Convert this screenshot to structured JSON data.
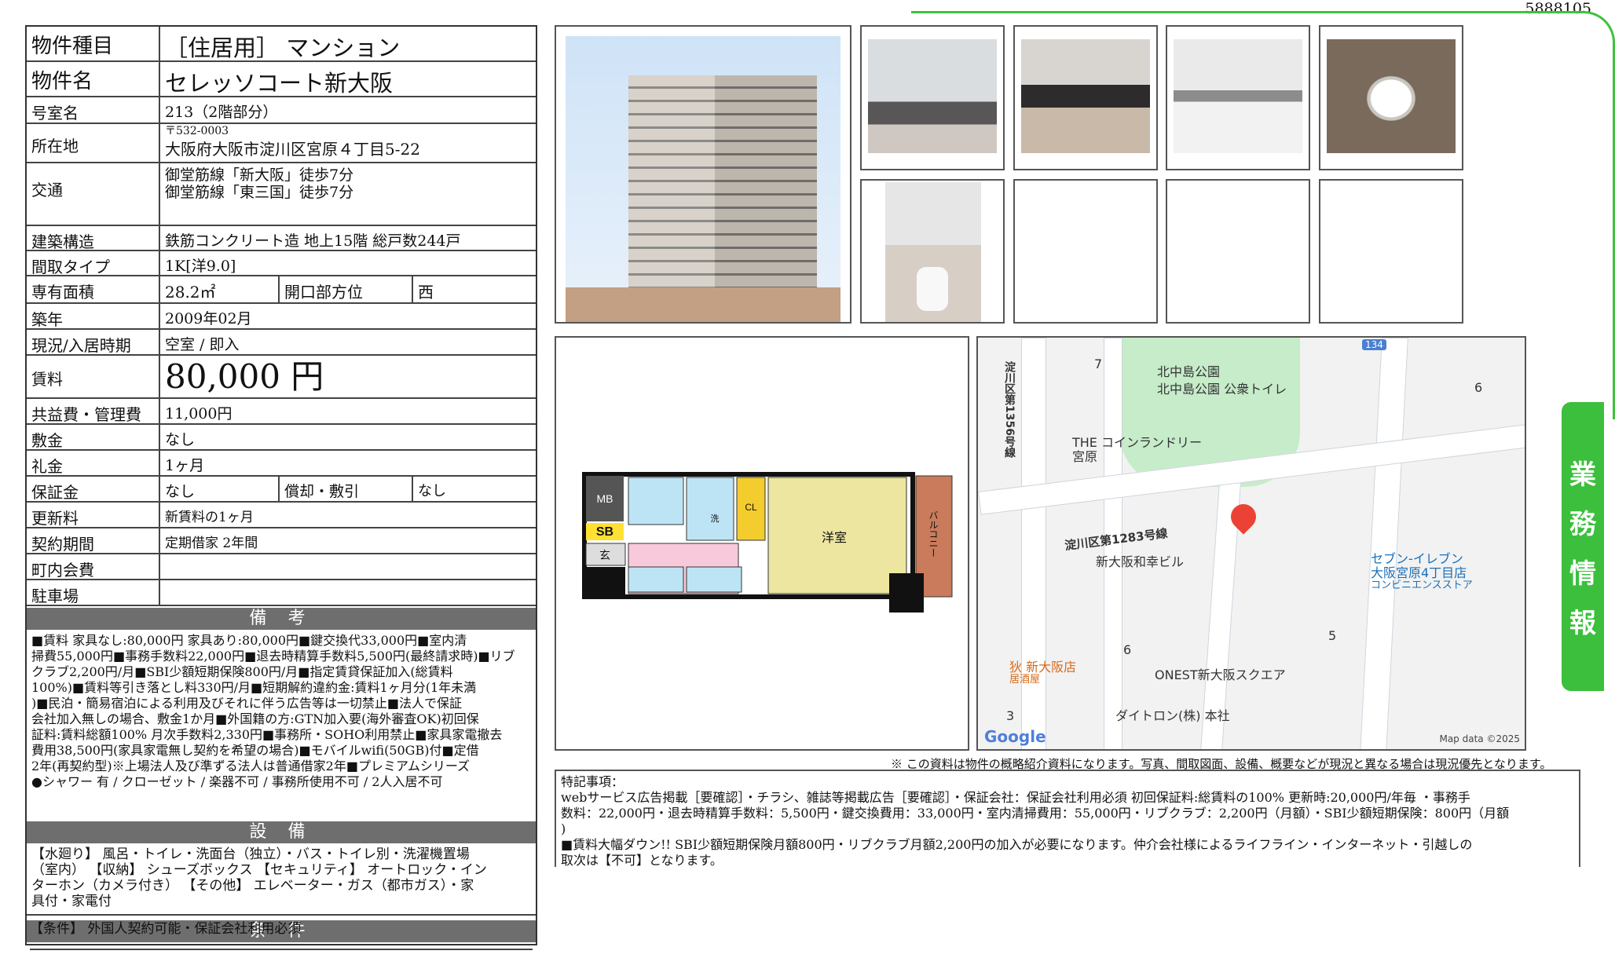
{
  "doc_id": "5888105",
  "side_tab": [
    "業",
    "務",
    "情",
    "報"
  ],
  "property": {
    "type_label": "物件種目",
    "type_value": "［住居用］ マンション",
    "name_label": "物件名",
    "name_value": "セレッソコート新大阪",
    "room_label": "号室名",
    "room_value": "213（2階部分）",
    "address_label": "所在地",
    "postal": "〒532-0003",
    "address": "大阪府大阪市淀川区宮原４丁目5-22",
    "transit_label": "交通",
    "transit_1": "御堂筋線「新大阪」徒歩7分",
    "transit_2": "御堂筋線「東三国」徒歩7分",
    "structure_label": "建築構造",
    "structure_value": "鉄筋コンクリート造 地上15階 総戸数244戸",
    "layout_label": "間取タイプ",
    "layout_value": "1K[洋9.0]",
    "area_label": "専有面積",
    "area_value": "28.2㎡",
    "opening_label": "開口部方位",
    "opening_value": "西",
    "built_label": "築年",
    "built_value": "2009年02月",
    "status_label": "現況/入居時期",
    "status_value": "空室 / 即入",
    "rent_label": "賃料",
    "rent_value": "80,000 円",
    "fee_label": "共益費・管理費",
    "fee_value": "11,000円",
    "deposit_label": "敷金",
    "deposit_value": "なし",
    "key_money_label": "礼金",
    "key_money_value": "1ヶ月",
    "guarantee_label": "保証金",
    "guarantee_value": "なし",
    "amort_label": "償却・敷引",
    "amort_value": "なし",
    "renewal_label": "更新料",
    "renewal_value": "新賃料の1ヶ月",
    "contract_label": "契約期間",
    "contract_value": "定期借家 2年間",
    "town_fee_label": "町内会費",
    "town_fee_value": "",
    "parking_label": "駐車場",
    "parking_value": ""
  },
  "remarks_header": "備 考",
  "remarks_lines": [
    "■賃料 家具なし:80,000円 家具あり:80,000円■鍵交換代33,000円■室内清",
    "掃費55,000円■事務手数料22,000円■退去時精算手数料5,500円(最終請求時)■リブ",
    "クラブ2,200円/月■SBI少額短期保険800円/月■指定賃貸保証加入(総賃料",
    "100%)■賃料等引き落とし料330円/月■短期解約違約金:賃料1ヶ月分(1年未満",
    ")■民泊・簡易宿泊による利用及びそれに伴う広告等は一切禁止■法人で保証",
    "会社加入無しの場合、敷金1か月■外国籍の方:GTN加入要(海外審査OK)初回保",
    "証料:賃料総額100% 月次手数料2,330円■事務所・SOHO利用禁止■家具家電撤去",
    "費用38,500円(家具家電無し契約を希望の場合)■モバイルwifi(50GB)付■定借",
    "2年(再契約型)※上場法人及び準ずる法人は普通借家2年■プレミアムシリーズ",
    "●シャワー 有 / クローゼット / 楽器不可 / 事務所使用不可 / 2人入居不可"
  ],
  "equipment_header": "設 備",
  "equipment_lines": [
    "【水廻り】 風呂・トイレ・洗面台（独立）・バス・トイレ別・洗濯機置場",
    "（室内） 【収納】 シューズボックス 【セキュリティ】 オートロック・イン",
    "ターホン（カメラ付き） 【その他】 エレベーター・ガス（都市ガス）・家",
    "具付・家電付"
  ],
  "conditions_header": "条 件",
  "conditions_text": "【条件】 外国人契約可能・保証会社利用必須",
  "floorplan": {
    "mb": "MB",
    "sb": "SB",
    "entrance": "玄",
    "cl": "CL",
    "wash": "洗",
    "western": "洋室",
    "balcony": "バルコニー"
  },
  "map": {
    "park_name_1": "北中島公園",
    "park_name_2": "北中島公園 公衆トイレ",
    "laundry_1": "THE コインランドリー",
    "laundry_2": "宮原",
    "road_1": "淀川区第1283号線",
    "road_2": "淀川区第1356号線",
    "route_number": "134",
    "building_1": "新大阪和幸ビル",
    "store_1": "セブン-イレブン",
    "store_2": "大阪宮原4丁目店",
    "store_3": "コンビニエンスストア",
    "restaurant_1": "狄 新大阪店",
    "restaurant_2": "居酒屋",
    "building_2": "ONEST新大阪スクエア",
    "building_3": "ダイトロン(株) 本社",
    "num_7": "7",
    "num_6a": "6",
    "num_6b": "6",
    "num_5": "5",
    "num_3": "3",
    "google": "Google",
    "credit": "Map data ©2025"
  },
  "disclaimer": "※ この資料は物件の概略紹介資料になります。写真、間取図面、設備、概要などが現況と異なる場合は現況優先となります。",
  "special_header": "特記事項：",
  "special_lines": [
    "webサービス広告掲載［要確認］・チラシ、雑誌等掲載広告［要確認］・保証会社：保証会社利用必須 初回保証料:総賃料の100% 更新時:20,000円/年毎 ・事務手",
    "数料：22,000円・退去時精算手数料：5,500円・鍵交換費用：33,000円・室内清掃費用：55,000円・リブクラブ：2,200円（月額）・SBI少額短期保険：800円（月額",
    ")",
    "■賃料大幅ダウン!! SBI少額短期保険月額800円・リブクラブ月額2,200円の加入が必要になります。仲介会社様によるライフライン・インターネット・引越しの",
    "取次は【不可】となります。"
  ]
}
